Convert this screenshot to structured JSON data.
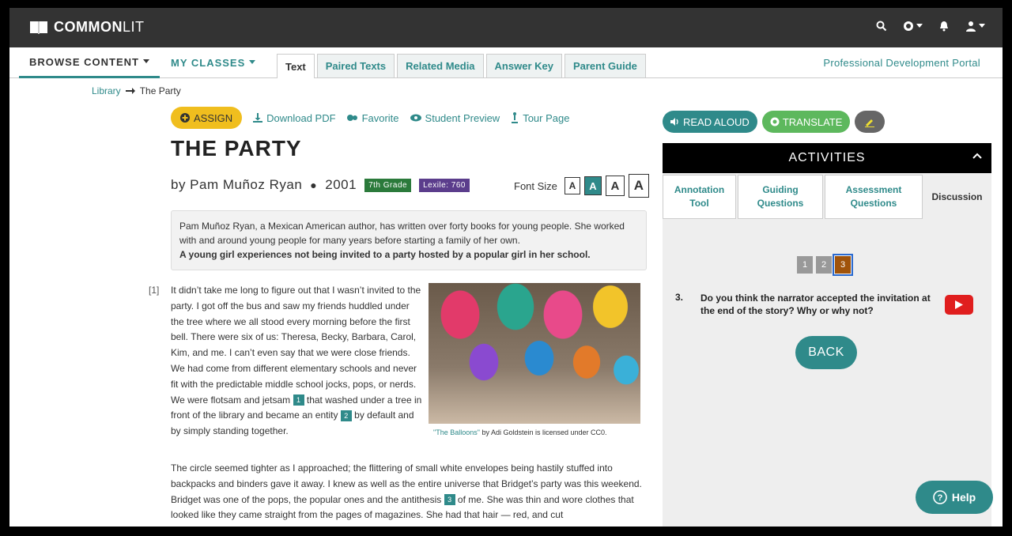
{
  "app": {
    "logo_bold": "COMMON",
    "logo_light": "LIT"
  },
  "topbar": {
    "icons": [
      "search-icon",
      "globe-icon",
      "bell-icon",
      "user-icon"
    ]
  },
  "nav": {
    "browse": "BROWSE CONTENT",
    "classes": "MY CLASSES",
    "tabs": [
      "Text",
      "Paired Texts",
      "Related Media",
      "Answer Key",
      "Parent Guide"
    ],
    "active_tab": "Text",
    "pd_portal": "Professional Development Portal"
  },
  "breadcrumb": {
    "library": "Library",
    "current": "The Party"
  },
  "toolbar": {
    "assign": "ASSIGN",
    "download_pdf": "Download PDF",
    "favorite": "Favorite",
    "student_preview": "Student Preview",
    "tour_page": "Tour Page"
  },
  "text": {
    "title": "THE PARTY",
    "author": "by Pam Muñoz Ryan",
    "year": "2001",
    "grade": "7th Grade",
    "lexile": "Lexile: 760",
    "font_size_label": "Font Size",
    "font_size_options": [
      "A",
      "A",
      "A",
      "A"
    ],
    "intro_1": "Pam Muñoz Ryan, a Mexican American author, has written over forty books for young people. She worked with and around young people for many years before starting a family of her own.",
    "intro_2": "A young girl experiences not being invited to a party hosted by a popular girl in her school.",
    "para1_num": "[1]",
    "para1_a": "It didn’t take me long to figure out that I wasn’t invited to the party. I got off the bus and saw my friends huddled under the tree where we all stood every morning before the first bell. There were six of us: Theresa, Becky, Barbara, Carol, Kim, and me. I can’t even say that we were close friends. We had come from different elementary schools and never fit with the predictable middle school jocks, pops, or nerds. We were flotsam and jetsam",
    "para1_b": "that washed under a tree in front of the library and became an entity",
    "para1_c": "by default and by simply standing together.",
    "para2_a": "The circle seemed tighter as I approached; the flittering of small white envelopes being hastily stuffed into backpacks and binders gave it away. I knew as well as the entire universe that Bridget’s party was this weekend. Bridget was one of the pops, the popular ones and the antithesis",
    "para2_b": "of me. She was thin and wore clothes that looked like they came straight from the pages of magazines. She had that hair — red, and cut",
    "annotations": [
      "1",
      "2",
      "3"
    ],
    "caption_link": "\"The Balloons\"",
    "caption_rest": "by Adi Goldstein is licensed under CC0."
  },
  "side": {
    "read_aloud": "READ ALOUD",
    "translate": "TRANSLATE",
    "activities": "ACTIVITIES",
    "tabs": [
      "Annotation Tool",
      "Guiding Questions",
      "Assessment Questions",
      "Discussion"
    ],
    "active_tab": "Discussion",
    "pages": [
      "1",
      "2",
      "3"
    ],
    "current_page": "3",
    "question_num": "3.",
    "question": "Do you think the narrator accepted the invitation at the end of the story? Why or why not?",
    "back": "BACK"
  },
  "help": "Help",
  "colors": {
    "accent": "#2f8a8a",
    "assign": "#f0be1e",
    "translate": "#5db85d",
    "topbar": "#333333",
    "grade": "#2b7a3b",
    "lexile": "#5b3d8c",
    "youtube": "#e01e1e"
  }
}
